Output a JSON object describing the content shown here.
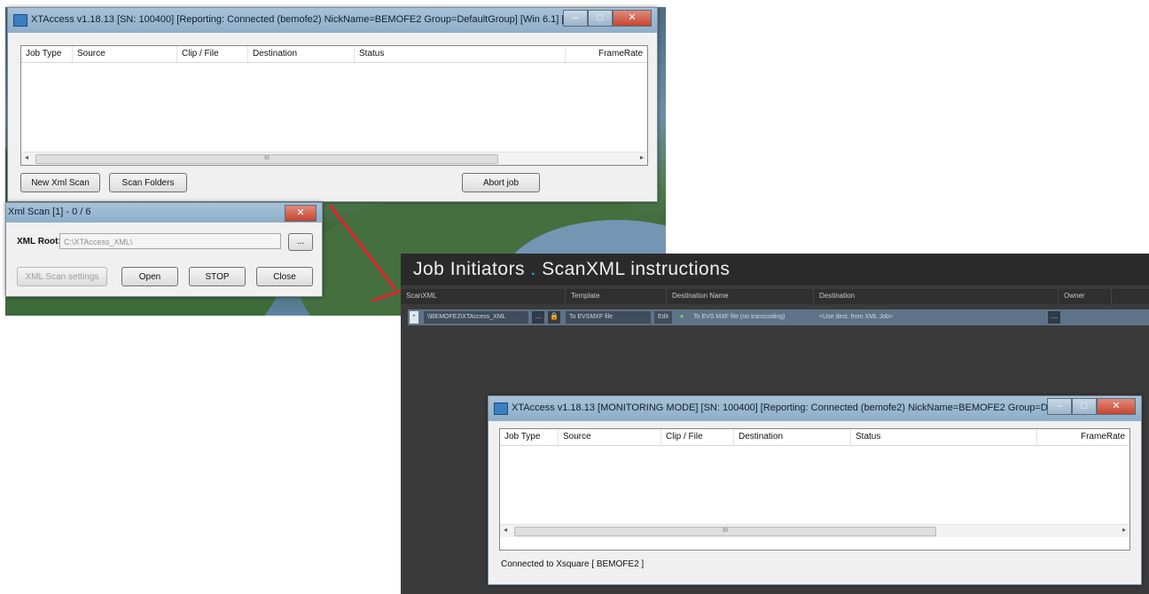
{
  "top_window": {
    "title": "XTAccess v1.18.13 [SN: 100400] [Reporting: Connected (bemofe2) NickName=BEMOFE2 Group=DefaultGroup] [Win 6.1] [Admin...",
    "columns": [
      "Job Type",
      "Source",
      "Clip / File",
      "Destination",
      "Status",
      "FrameRate"
    ],
    "scroll_thumb": "III",
    "buttons": {
      "new_xml_scan": "New Xml Scan",
      "scan_folders": "Scan Folders",
      "abort_job": "Abort job"
    }
  },
  "scan_dialog": {
    "title": "Xml Scan [1] - 0 / 6",
    "xml_root_label": "XML Root:",
    "xml_root_value": "C:\\XTAccess_XML\\",
    "browse_label": "...",
    "buttons": {
      "settings": "XML Scan settings",
      "open": "Open",
      "stop": "STOP",
      "close": "Close"
    }
  },
  "job_initiators": {
    "banner_left": "Job Initiators",
    "banner_dot": ".",
    "banner_right": "ScanXML instructions",
    "columns": [
      "ScanXML",
      "Template",
      "Destination Name",
      "Destination",
      "Owner"
    ],
    "row": {
      "scan_path": "\\\\BEMOFE2\\XTAccess_XML",
      "browse": "...",
      "template": "To EVSMXF file",
      "edit": "Edit",
      "destination_name": "To EVS MXF file (no transcoding)",
      "destination": "<Use dest. from XML Job>",
      "dest_browse": "..."
    }
  },
  "bottom_window": {
    "title": "XTAccess v1.18.13 [MONITORING MODE] [SN: 100400] [Reporting: Connected (bemofe2) NickName=BEMOFE2 Group=DefaultG...",
    "columns": [
      "Job Type",
      "Source",
      "Clip / File",
      "Destination",
      "Status",
      "FrameRate"
    ],
    "scroll_thumb": "III",
    "status_text": "Connected to Xsquare [ BEMOFE2 ]"
  },
  "colors": {
    "arrow": "#e3222a",
    "accent_dot": "#2fb4e6"
  }
}
